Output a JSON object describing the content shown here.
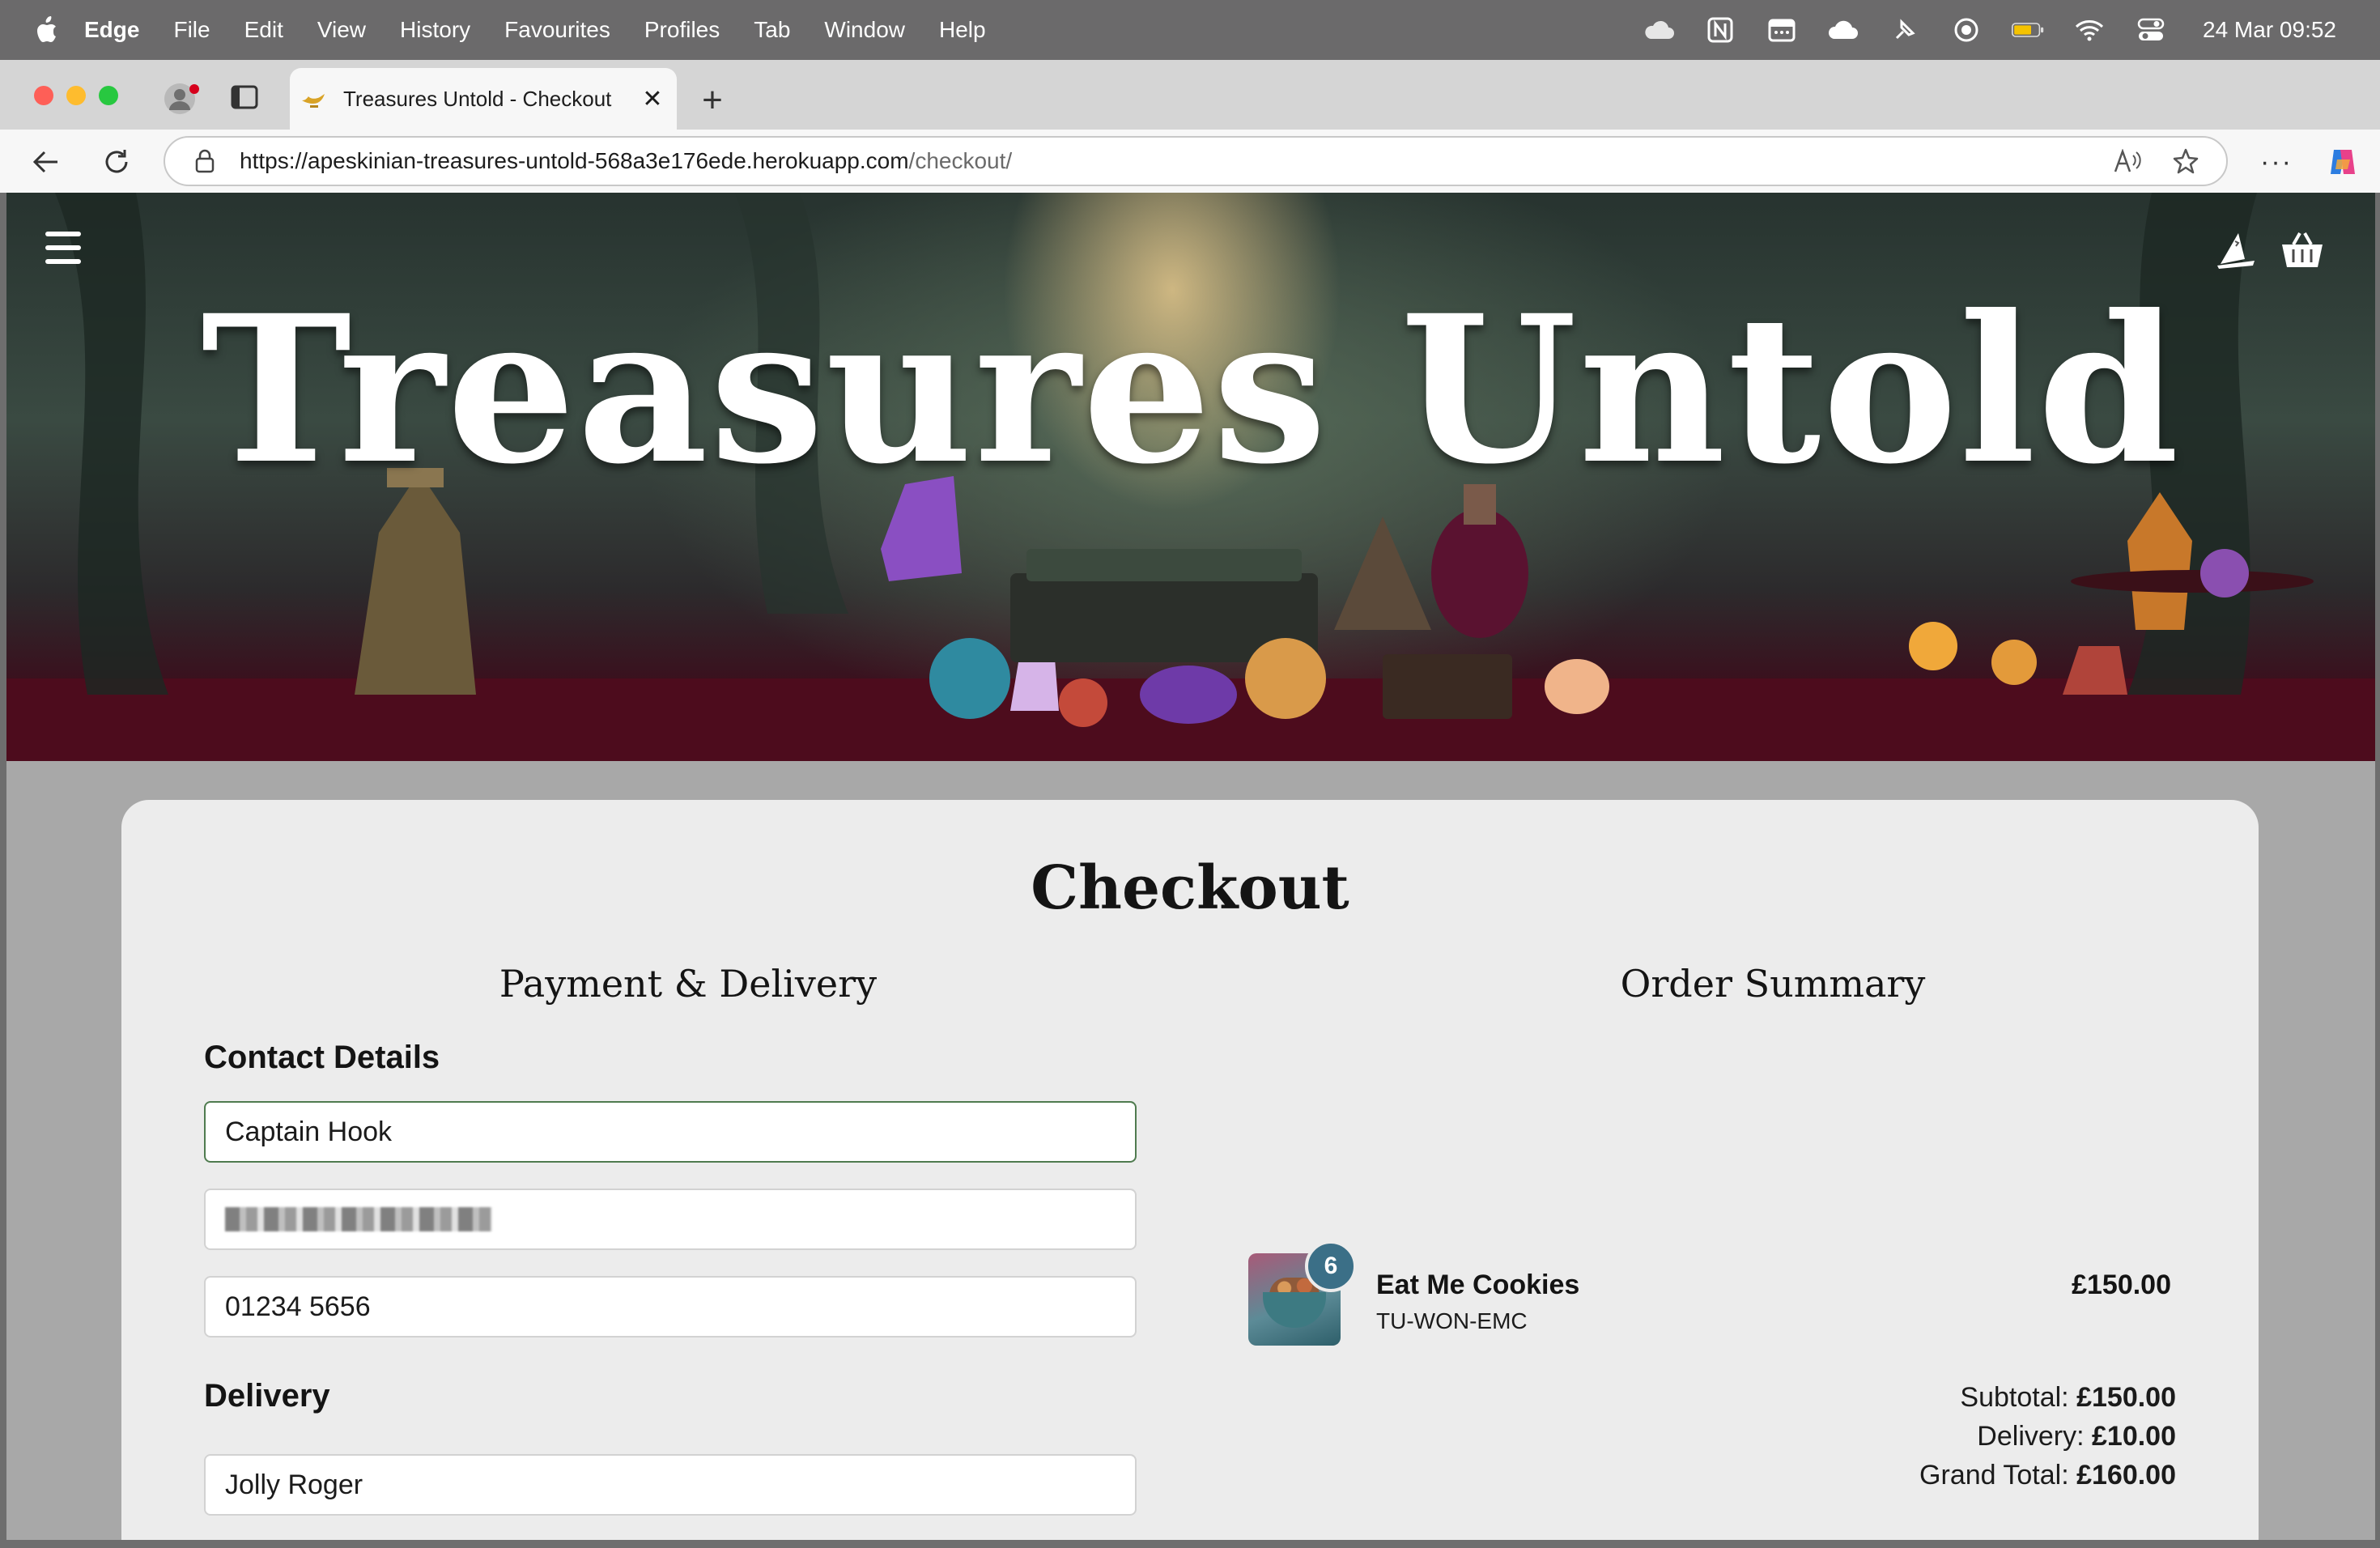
{
  "menubar": {
    "app_name": "Edge",
    "items": [
      "File",
      "Edit",
      "View",
      "History",
      "Favourites",
      "Profiles",
      "Tab",
      "Window",
      "Help"
    ],
    "clock": "24 Mar  09:52",
    "status_icons": [
      "cloud-icon",
      "notion-icon",
      "calendar-icon",
      "creative-cloud-icon",
      "pin-icon",
      "record-icon",
      "battery-icon",
      "wifi-icon",
      "control-center-icon"
    ]
  },
  "browser": {
    "tab_title": "Treasures Untold - Checkout",
    "new_tab_symbol": "+",
    "close_symbol": "✕",
    "url_host": "https://apeskinian-treasures-untold-568a3e176ede.herokuapp.com",
    "url_path": "/checkout/",
    "more_symbol": "···"
  },
  "hero": {
    "title": "Treasures Untold"
  },
  "page": {
    "title": "Checkout",
    "left_heading": "Payment & Delivery",
    "right_heading": "Order Summary",
    "contact_label": "Contact Details",
    "contact_fields": {
      "full_name": "Captain Hook",
      "email": "",
      "phone": "01234 5656"
    },
    "delivery_label": "Delivery",
    "delivery_fields": {
      "address_line": "Jolly Roger"
    }
  },
  "order": {
    "items": [
      {
        "quantity": "6",
        "name": "Eat Me Cookies",
        "sku": "TU-WON-EMC",
        "price": "£150.00"
      }
    ],
    "subtotal_label": "Subtotal:",
    "subtotal": "£150.00",
    "delivery_label": "Delivery:",
    "delivery": "£10.00",
    "grand_total_label": "Grand Total:",
    "grand_total": "£160.00"
  },
  "colors": {
    "accent_badge": "#3b6f87",
    "focused_border": "#4f7b4f"
  }
}
